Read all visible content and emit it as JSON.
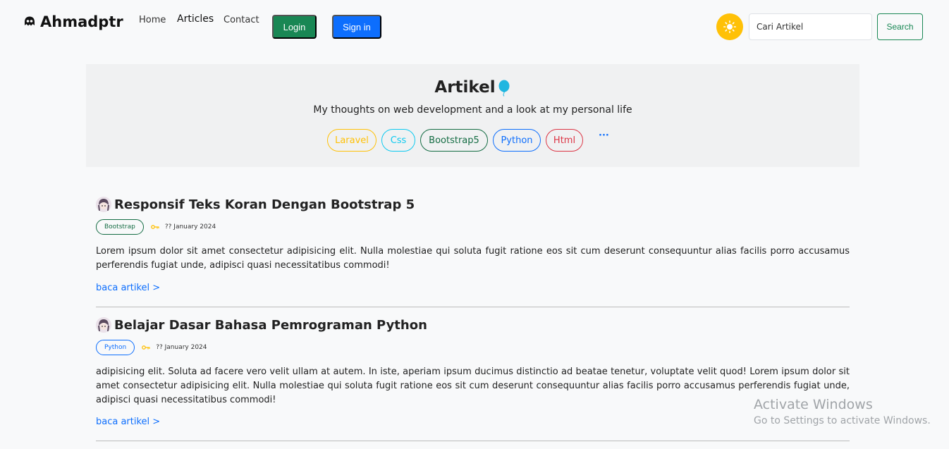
{
  "navbar": {
    "brand": "Ahmadptr",
    "links": [
      {
        "label": "Home"
      },
      {
        "label": "Articles"
      },
      {
        "label": "Contact"
      }
    ],
    "login_label": "Login",
    "signin_label": "Sign in",
    "search_placeholder": "Cari Artikel",
    "search_label": "Search",
    "theme_icon": "sun-icon",
    "colors": {
      "login": "#198754",
      "signin": "#0d6efd",
      "theme": "#ffc107"
    }
  },
  "hero": {
    "title": "Artikel",
    "subtitle": "My thoughts on web development and a look at my personal life",
    "tags": [
      "Laravel",
      "Css",
      "Bootstrap5",
      "Python",
      "Html"
    ],
    "more": "···"
  },
  "articles": [
    {
      "title": "Responsif Teks Koran Dengan Bootstrap 5",
      "category": "Bootstrap",
      "date": "?? January 2024",
      "excerpt": "Lorem ipsum dolor sit amet consectetur adipisicing elit. Nulla molestiae qui soluta fugit ratione eos sit cum deserunt consequuntur alias facilis porro accusamus perferendis fugiat unde, adipisci quasi necessitatibus commodi!",
      "read_more": "baca artikel >"
    },
    {
      "title": "Belajar Dasar Bahasa Pemrograman Python",
      "category": "Python",
      "date": "?? January 2024",
      "excerpt": "adipisicing elit. Soluta ad facere vero velit ullam at autem. In iste, aperiam ipsum ducimus distinctio ad beatae tenetur, voluptate velit quod! Lorem ipsum dolor sit amet consectetur adipisicing elit. Nulla molestiae qui soluta fugit ratione eos sit cum deserunt consequuntur alias facilis porro accusamus perferendis fugiat unde, adipisci quasi necessitatibus commodi!",
      "read_more": "baca artikel >"
    }
  ],
  "watermark": {
    "title": "Activate Windows",
    "subtitle": "Go to Settings to activate Windows."
  }
}
